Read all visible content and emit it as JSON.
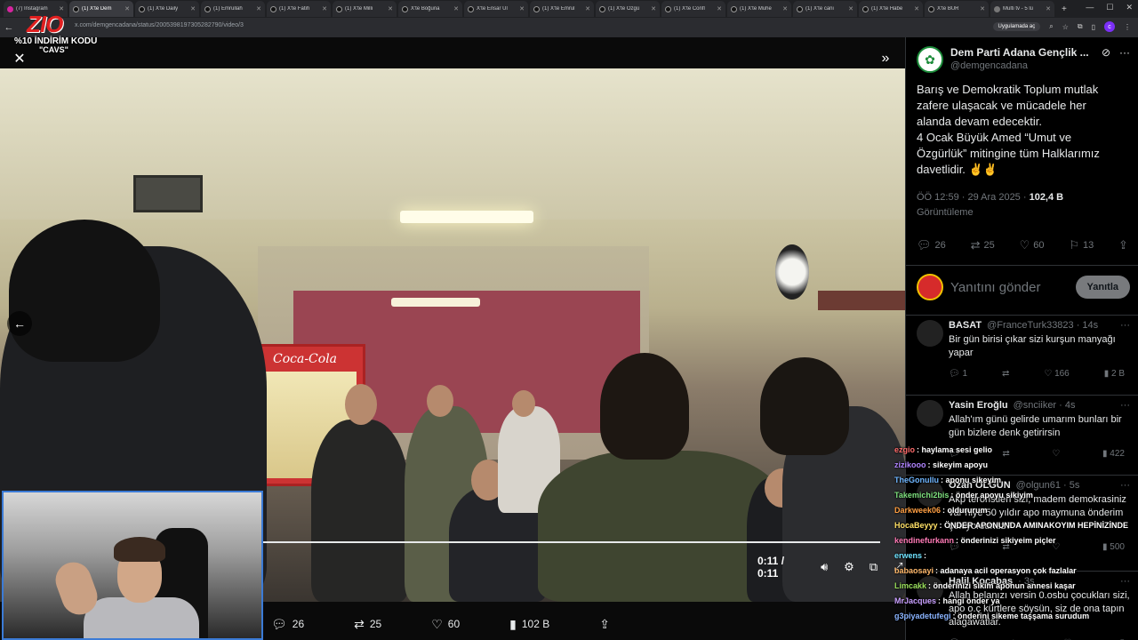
{
  "browser": {
    "tabs": [
      {
        "title": "(7) Instagram",
        "icon": "instagram-icon",
        "active": false
      },
      {
        "title": "(1) X'te Dem",
        "icon": "x-icon",
        "active": true
      },
      {
        "title": "(1) X'te Daily",
        "icon": "x-icon",
        "active": false
      },
      {
        "title": "(1) Emrullah",
        "icon": "x-icon",
        "active": false
      },
      {
        "title": "(1) X'te Fatih",
        "icon": "x-icon",
        "active": false
      },
      {
        "title": "(1) X'te Milli",
        "icon": "x-icon",
        "active": false
      },
      {
        "title": "X'te Boğuna",
        "icon": "x-icon",
        "active": false
      },
      {
        "title": "X'te Ensar Ul",
        "icon": "x-icon",
        "active": false
      },
      {
        "title": "(1) X'te Emrul",
        "icon": "x-icon",
        "active": false
      },
      {
        "title": "(1) X'te Özgü",
        "icon": "x-icon",
        "active": false
      },
      {
        "title": "(1) X'te Confl",
        "icon": "x-icon",
        "active": false
      },
      {
        "title": "(1) X'te Muhe",
        "icon": "x-icon",
        "active": false
      },
      {
        "title": "(1) X'te cani",
        "icon": "x-icon",
        "active": false
      },
      {
        "title": "(1) X'te Habe",
        "icon": "x-icon",
        "active": false
      },
      {
        "title": "X'te BUR",
        "icon": "x-icon",
        "active": false
      },
      {
        "title": "Multi tv - 5 lü",
        "icon": "globe-icon",
        "active": false
      }
    ],
    "url": "x.com/demgencadana/status/2005398197305282790/video/3",
    "app_pill": "Uygulamada aç",
    "profile_initial": "c"
  },
  "overlay": {
    "logo_text": "ZIO",
    "promo_line1": "%10 İNDİRİM KODU",
    "promo_line2": "\"CAVS\""
  },
  "video": {
    "time": "0:11 / 0:11",
    "progress_fraction": 1.0,
    "fridge_brand": "Coca-Cola"
  },
  "post_actions": {
    "replies": "26",
    "reposts": "25",
    "likes": "60",
    "views": "102 B"
  },
  "post": {
    "author_name": "Dem Parti Adana Gençlik ...",
    "author_handle": "@demgencadana",
    "text": "Barış ve Demokratik Toplum mutlak zafere ulaşacak ve mücadele her alanda devam edecektir.\n4 Ocak Büyük Amed “Umut ve Özgürlük” mitingine tüm Halklarımız davetlidir. ✌️✌️",
    "time": "ÖÖ 12:59 · 29 Ara 2025 · ",
    "views": "102,4 B",
    "views_label": "Görüntüleme",
    "replies": "26",
    "reposts": "25",
    "likes": "60",
    "bookmarks": "13"
  },
  "reply_box": {
    "placeholder": "Yanıtını gönder",
    "button": "Yanıtla"
  },
  "replies": [
    {
      "name": "BASAT",
      "handle": "@FranceTurk33823 · 14s",
      "text": "Bir gün birisi çıkar sizi kurşun manyağı yapar",
      "replies": "1",
      "reposts": "",
      "likes": "166",
      "views": "2 B"
    },
    {
      "name": "Yasin Eroğlu",
      "handle": "@snciiker · 4s",
      "text": "Allah'ım günü gelirde umarım bunları bir gün bizlere denk getirirsin",
      "replies": "",
      "reposts": "",
      "likes": "",
      "views": "422"
    },
    {
      "name": "Ozan OLGUN",
      "handle": "@olgun61 · 5s",
      "text": "Akp teröristleri sizi, madem demokrasiniz var niye 50 yıldır apo maymuna önderim çekiyorsunuz?",
      "replies": "",
      "reposts": "",
      "likes": "",
      "views": "500"
    },
    {
      "name": "Halil Kocabaş",
      "handle": "· 3s",
      "text": "Allah belanızı versin 0.osbu çocukları sizi, apo o.ç kürtlere söysün, siz de ona tapın alagawatlar.",
      "replies": "",
      "reposts": "",
      "likes": "",
      "views": ""
    }
  ],
  "chat": [
    {
      "user": "ezgio",
      "msg": ": haylama sesi gelio",
      "color": "#ff6b6b"
    },
    {
      "user": "zizikooo",
      "msg": ": sikeyim apoyu",
      "color": "#b084ff"
    },
    {
      "user": "TheGonullu",
      "msg": ": aponu sikeyim",
      "color": "#6fb6ff"
    },
    {
      "user": "Takemichi2bis",
      "msg": ": önder apoyu sikiyim",
      "color": "#7ee07e"
    },
    {
      "user": "Darkweek06",
      "msg": ": oldururum",
      "color": "#ff9f43"
    },
    {
      "user": "HocaBeyyy",
      "msg": ": ÖNDER APONUNDA AMINAKOYIM HEPİNİZİNDE",
      "color": "#ffe066"
    },
    {
      "user": "kendinefurkann",
      "msg": ": önderinizi sikiyeim piçler",
      "color": "#ff7ab6"
    },
    {
      "user": "erwens",
      "msg": ":",
      "color": "#6fe3ff"
    },
    {
      "user": "babaosayi",
      "msg": ": adanaya acil operasyon çok fazlalar",
      "color": "#ffb86b"
    },
    {
      "user": "Limcakk",
      "msg": ": önderinizi sikim aponun annesi kaşar",
      "color": "#9be15d"
    },
    {
      "user": "MrJacques",
      "msg": ": hangi önder ya",
      "color": "#c9a0ff"
    },
    {
      "user": "g3piyadetufegi",
      "msg": ": önderini sikeme taşşama surudum",
      "color": "#8ab4ff"
    }
  ],
  "colors": {
    "x_bg": "#000000",
    "text": "#e7e9ea",
    "muted": "#71767b",
    "border": "#2f3336",
    "webcam_border": "#3b7bd6"
  }
}
